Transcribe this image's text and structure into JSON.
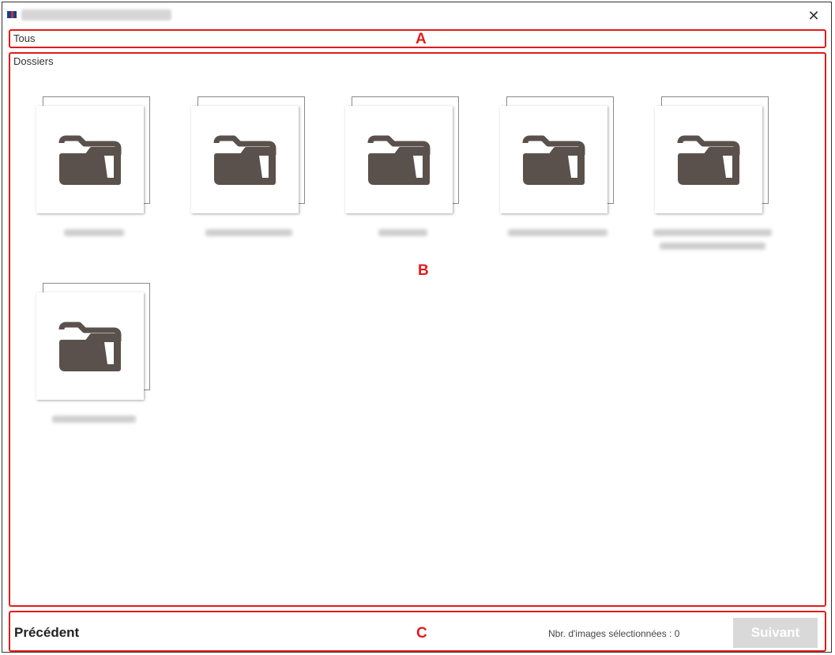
{
  "window": {
    "close_glyph": "✕"
  },
  "breadcrumb": {
    "label": "Tous"
  },
  "folders_section": {
    "heading": "Dossiers"
  },
  "folders": [
    {
      "icon": "folder-icon"
    },
    {
      "icon": "folder-icon"
    },
    {
      "icon": "folder-icon"
    },
    {
      "icon": "folder-icon"
    },
    {
      "icon": "folder-icon"
    },
    {
      "icon": "folder-icon"
    }
  ],
  "footer": {
    "back_label": "Précédent",
    "count_label": "Nbr. d'images sélectionnées : 0",
    "next_label": "Suivant"
  },
  "annotations": {
    "a": "A",
    "b": "B",
    "c": "C"
  },
  "colors": {
    "annotation": "#e31b1b",
    "folder_icon": "#5a514c",
    "next_disabled": "#d9d9d9"
  }
}
